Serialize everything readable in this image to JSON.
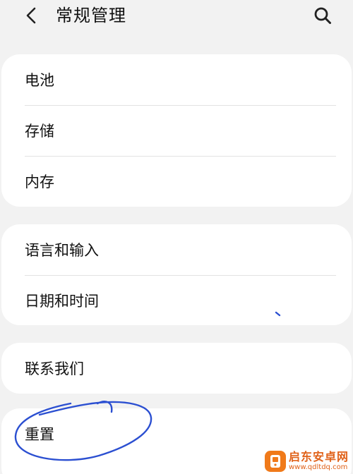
{
  "header": {
    "title": "常规管理",
    "back_icon": "chevron-left-icon",
    "search_icon": "search-icon"
  },
  "groups": [
    {
      "items": [
        {
          "label": "电池"
        },
        {
          "label": "存储"
        },
        {
          "label": "内存"
        }
      ]
    },
    {
      "items": [
        {
          "label": "语言和输入"
        },
        {
          "label": "日期和时间"
        }
      ]
    },
    {
      "items": [
        {
          "label": "联系我们"
        }
      ]
    },
    {
      "items": [
        {
          "label": "重置"
        }
      ]
    }
  ],
  "annotation": {
    "color": "#2b4fd1"
  },
  "watermark": {
    "main": "启东安卓网",
    "sub": "www.qdltdq.com",
    "color": "#f07a1a"
  }
}
